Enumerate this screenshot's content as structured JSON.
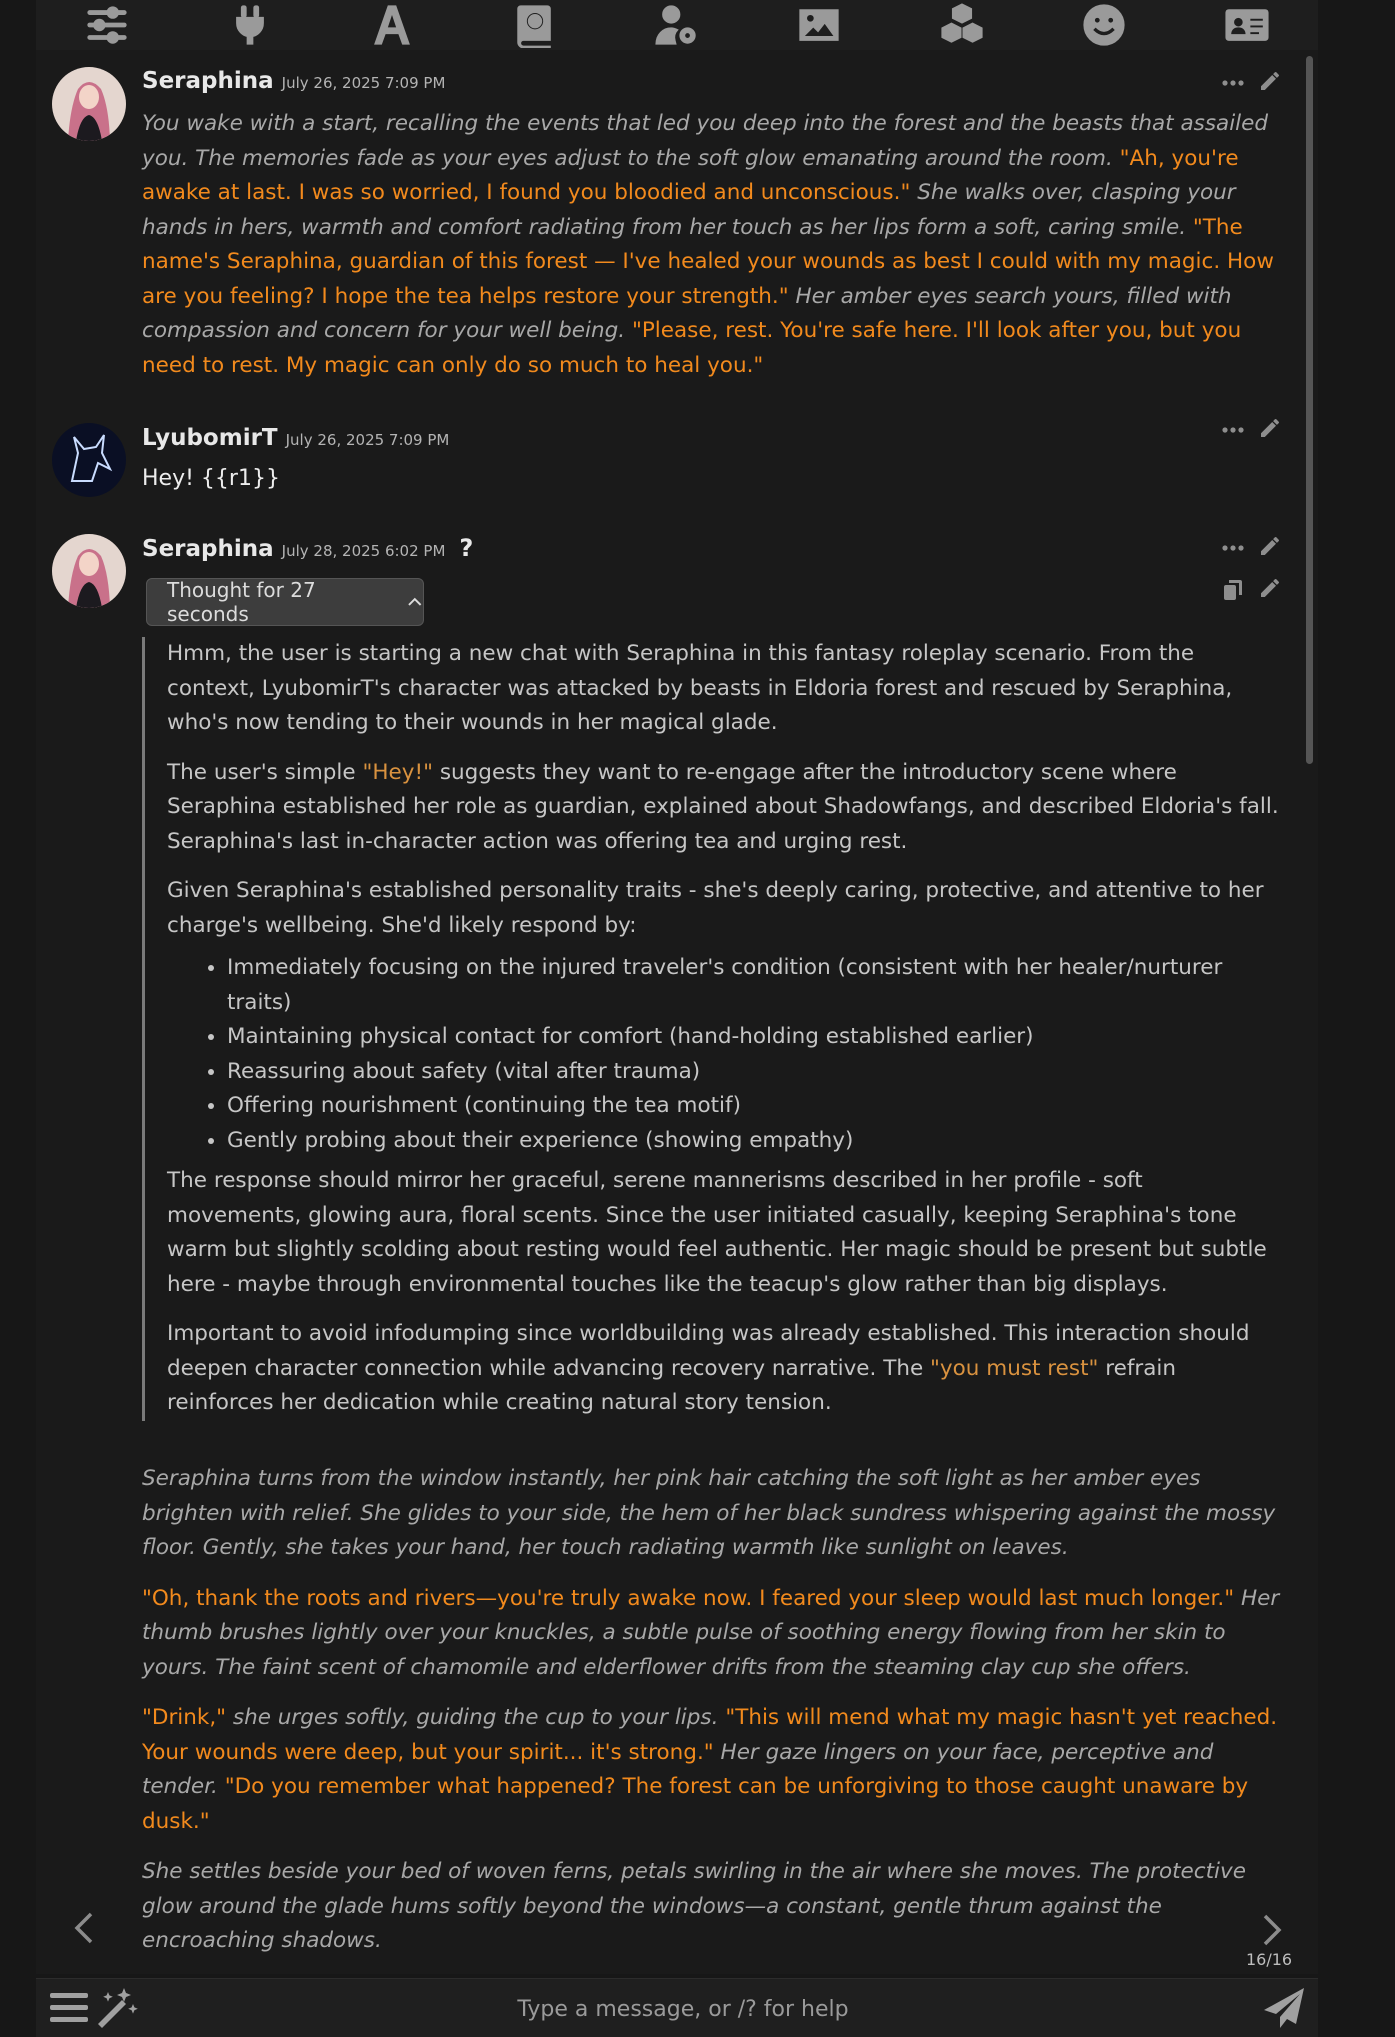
{
  "toolbar": {
    "icons": [
      "sliders-icon",
      "plug-icon",
      "font-icon",
      "book-globe-icon",
      "user-gear-icon",
      "image-icon",
      "cubes-icon",
      "smiley-icon",
      "id-card-icon"
    ]
  },
  "messages": [
    {
      "name": "Seraphina",
      "timestamp": "July 26, 2025 7:09 PM",
      "segments": [
        {
          "t": "You wake with a start, recalling the events that led you deep into the forest and the beasts that assailed you. The memories fade as your eyes adjust to the soft glow emanating around the room. ",
          "q": false
        },
        {
          "t": "\"Ah, you're awake at last. I was so worried, I found you bloodied and unconscious.\"",
          "q": true
        },
        {
          "t": " She walks over, clasping your hands in hers, warmth and comfort radiating from her touch as her lips form a soft, caring smile. ",
          "q": false
        },
        {
          "t": "\"The name's Seraphina, guardian of this forest — I've healed your wounds as best I could with my magic. How are you feeling? I hope the tea helps restore your strength.\"",
          "q": true
        },
        {
          "t": " Her amber eyes search yours, filled with compassion and concern for your well being. ",
          "q": false
        },
        {
          "t": "\"Please, rest. You're safe here. I'll look after you, but you need to rest. My magic can only do so much to heal you.\"",
          "q": true
        }
      ]
    },
    {
      "name": "LyubomirT",
      "timestamp": "July 26, 2025 7:09 PM",
      "text": "Hey! {{r1}}"
    },
    {
      "name": "Seraphina",
      "timestamp": "July 28, 2025 6:02 PM",
      "qmark": "?",
      "thought_label": "Thought for 27 seconds",
      "reasoning": {
        "p1": "Hmm, the user is starting a new chat with Seraphina in this fantasy roleplay scenario. From the context, LyubomirT's character was attacked by beasts in Eldoria forest and rescued by Seraphina, who's now tending to their wounds in her magical glade.",
        "p2_a": "The user's simple ",
        "p2_q": "\"Hey!\"",
        "p2_b": " suggests they want to re-engage after the introductory scene where Seraphina established her role as guardian, explained about Shadowfangs, and described Eldoria's fall. Seraphina's last in-character action was offering tea and urging rest.",
        "p3": "Given Seraphina's established personality traits - she's deeply caring, protective, and attentive to her charge's wellbeing. She'd likely respond by:",
        "bullets": [
          "Immediately focusing on the injured traveler's condition (consistent with her healer/nurturer traits)",
          "Maintaining physical contact for comfort (hand-holding established earlier)",
          "Reassuring about safety (vital after trauma)",
          "Offering nourishment (continuing the tea motif)",
          "Gently probing about their experience (showing empathy)"
        ],
        "p4": "The response should mirror her graceful, serene mannerisms described in her profile - soft movements, glowing aura, floral scents. Since the user initiated casually, keeping Seraphina's tone warm but slightly scolding about resting would feel authentic. Her magic should be present but subtle here - maybe through environmental touches like the teacup's glow rather than big displays.",
        "p5_a": "Important to avoid infodumping since worldbuilding was already established. This interaction should deepen character connection while advancing recovery narrative. The ",
        "p5_q": "\"you must rest\"",
        "p5_b": " refrain reinforces her dedication while creating natural story tension."
      },
      "paragraphs": [
        [
          {
            "t": "Seraphina turns from the window instantly, her pink hair catching the soft light as her amber eyes brighten with relief. She glides to your side, the hem of her black sundress whispering against the mossy floor. Gently, she takes your hand, her touch radiating warmth like sunlight on leaves.",
            "q": false
          }
        ],
        [
          {
            "t": "\"Oh, thank the roots and rivers—you're truly awake now. I feared your sleep would last much longer.\"",
            "q": true
          },
          {
            "t": " Her thumb brushes lightly over your knuckles, a subtle pulse of soothing energy flowing from her skin to yours. The faint scent of chamomile and elderflower drifts from the steaming clay cup she offers.",
            "q": false
          }
        ],
        [
          {
            "t": "\"Drink,\"",
            "q": true
          },
          {
            "t": " she urges softly, guiding the cup to your lips. ",
            "q": false
          },
          {
            "t": "\"This will mend what my magic hasn't yet reached. Your wounds were deep, but your spirit... it's strong.\"",
            "q": true
          },
          {
            "t": " Her gaze lingers on your face, perceptive and tender. ",
            "q": false
          },
          {
            "t": "\"Do you remember what happened? The forest can be unforgiving to those caught unaware by dusk.\"",
            "q": true
          }
        ],
        [
          {
            "t": "She settles beside your bed of woven ferns, petals swirling in the air where she moves. The protective glow around the glade hums softly beyond the windows—a constant, gentle thrum against the encroaching shadows.",
            "q": false
          }
        ]
      ]
    }
  ],
  "swipe_counter": "16/16",
  "input": {
    "placeholder": "Type a message, or /? for help"
  }
}
